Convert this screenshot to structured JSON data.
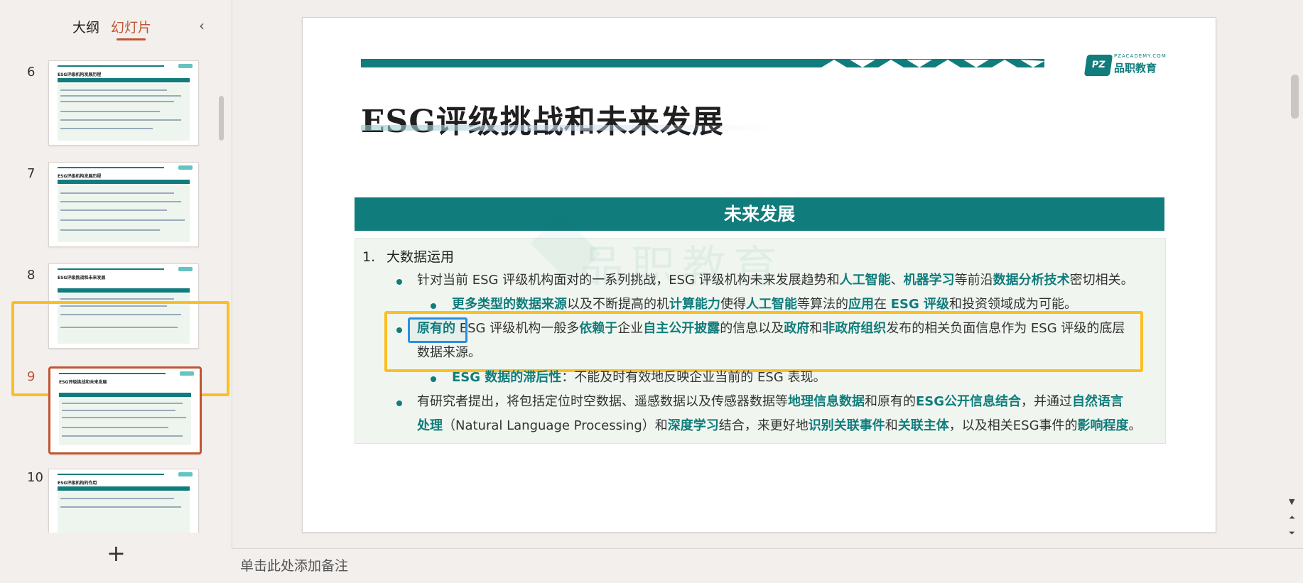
{
  "panel": {
    "tab_outline": "大纲",
    "tab_slides": "幻灯片",
    "collapse_icon": "‹",
    "add_icon": "+"
  },
  "thumbnails": [
    {
      "num": "6",
      "title": "ESG评级机构发展历程"
    },
    {
      "num": "7",
      "title": "ESG评级机构发展历程"
    },
    {
      "num": "8",
      "title": "ESG评级挑战和未来发展"
    },
    {
      "num": "9",
      "title": "ESG评级挑战和未来发展"
    },
    {
      "num": "10",
      "title": "ESG评级机构的作用"
    }
  ],
  "slide": {
    "logo_small": "PZACADEMY.COM",
    "logo_mark": "PZ",
    "logo_name": "品职教育",
    "title": "ESG评级挑战和未来发展",
    "section_header": "未来发展",
    "watermark": "品职教育",
    "item1_num": "1.",
    "item1_text": "大数据运用",
    "b1": {
      "t1": "针对当前 ESG 评级机构面对的一系列挑战，ESG 评级机构未来发展趋势和",
      "h1": "人工智能",
      "t2": "、",
      "h2": "机器学习",
      "t3": "等前沿",
      "h3": "数据分析技术",
      "t4": "密切相关。"
    },
    "b1s": {
      "h1": "更多类型的数据来源",
      "t1": "以及不断提高的机",
      "h2": "计算能力",
      "t2": "使得",
      "h3": "人工智能",
      "t3": "等算法的",
      "h4": "应用",
      "t4": "在 ",
      "h5": "ESG 评级",
      "t5": "和投资领域成为可能。"
    },
    "b2": {
      "h1": "原有的",
      "t1": " ESG 评级机构一般多",
      "h2": "依赖于",
      "t2": "企业",
      "h3": "自主公开披露",
      "t3": "的信息以及",
      "h4": "政府",
      "t4": "和",
      "h5": "非政府组织",
      "t5": "发布的相关负面信息作为 ESG 评级的底层",
      "t6": "数据来源。"
    },
    "b2s": {
      "h1": "ESG 数据的滞后性",
      "t1": "：不能及时有效地反映企业当前的 ESG 表现。"
    },
    "b3": {
      "t1": "有研究者提出，将包括定位时空数据、遥感数据以及传感器数据等",
      "h1": "地理信息数据",
      "t2": "和原有的",
      "h2": "ESG公开信息结合",
      "t3": "，并通过",
      "h3": "自然语言",
      "h3b": "处理",
      "t4": "（Natural Language Processing）和",
      "h4": "深度学习",
      "t5": "结合，来更好地",
      "h5": "识别关联事件",
      "t6": "和",
      "h6": "关联主体",
      "t7": "，以及相关ESG事件的",
      "h7": "影响程度",
      "t8": "。"
    }
  },
  "notes": {
    "placeholder": "单击此处添加备注"
  },
  "colors": {
    "accent": "#c15531",
    "teal": "#117c7c",
    "highlight": "#fbbf24",
    "blue": "#2a8fe0"
  }
}
